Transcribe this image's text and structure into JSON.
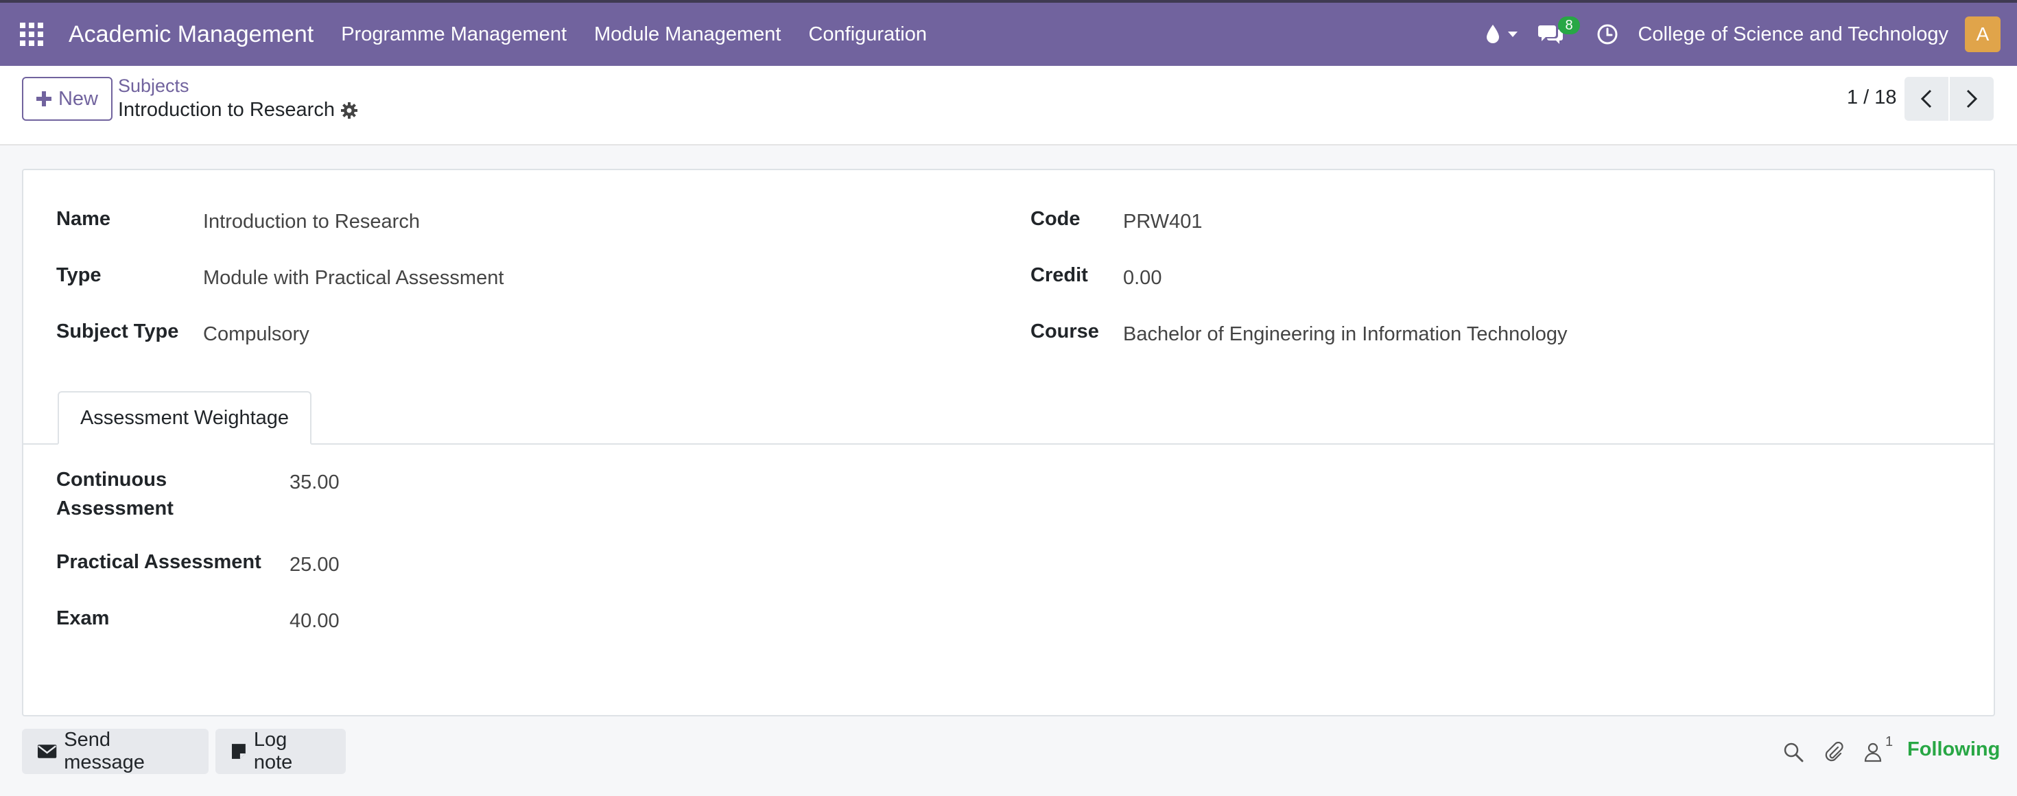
{
  "navbar": {
    "app_name": "Academic Management",
    "menu": [
      "Programme Management",
      "Module Management",
      "Configuration"
    ],
    "messages_badge": "8",
    "company": "College of Science and Technology",
    "avatar_letter": "A",
    "color": "#71639e"
  },
  "control_panel": {
    "new_label": "New",
    "breadcrumb_parent": "Subjects",
    "breadcrumb_current": "Introduction to Research",
    "pager_value": "1 / 18"
  },
  "form": {
    "left_fields": [
      {
        "label": "Name",
        "value": "Introduction to Research"
      },
      {
        "label": "Type",
        "value": "Module with Practical Assessment"
      },
      {
        "label": "Subject Type",
        "value": "Compulsory"
      }
    ],
    "right_fields": [
      {
        "label": "Code",
        "value": "PRW401"
      },
      {
        "label": "Credit",
        "value": "0.00"
      },
      {
        "label": "Course",
        "value": "Bachelor of Engineering in Information Technology"
      }
    ],
    "tab_label": "Assessment Weightage",
    "weightage": [
      {
        "label_line1": "Continuous",
        "label_line2": "Assessment",
        "value": "35.00"
      },
      {
        "label": "Practical Assessment",
        "value": "25.00"
      },
      {
        "label": "Exam",
        "value": "40.00"
      }
    ]
  },
  "chatter": {
    "send_message": "Send message",
    "log_note": "Log note",
    "follower_count": "1",
    "following": "Following"
  }
}
